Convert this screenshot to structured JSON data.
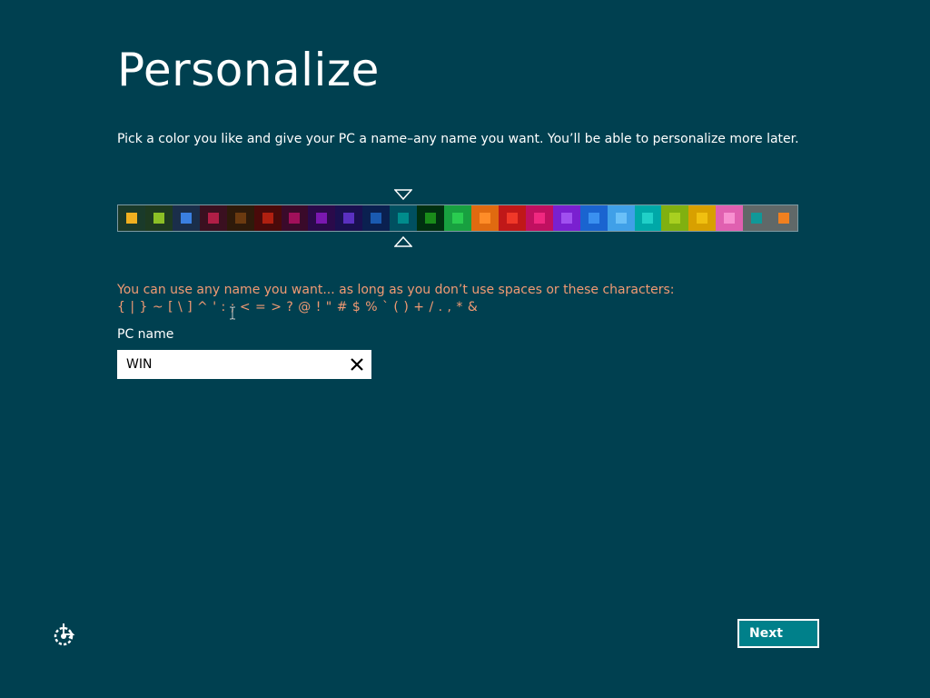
{
  "page": {
    "title": "Personalize",
    "subtitle": "Pick a color you like and give your PC a name–any name you want. You’ll be able to personalize more later.",
    "background_color": "#004050"
  },
  "color_picker": {
    "selected_index": 10,
    "swatches": [
      {
        "bg": "#1a3a2a",
        "fg": "#f0b020"
      },
      {
        "bg": "#1e3a20",
        "fg": "#8cbf26"
      },
      {
        "bg": "#1a2e4a",
        "fg": "#3a7fe0"
      },
      {
        "bg": "#3a1020",
        "fg": "#b01e46"
      },
      {
        "bg": "#2e1a0a",
        "fg": "#6b3a10"
      },
      {
        "bg": "#4a0a0a",
        "fg": "#b02010"
      },
      {
        "bg": "#3a0a2a",
        "fg": "#a0105a"
      },
      {
        "bg": "#2a0a4a",
        "fg": "#7a18b0"
      },
      {
        "bg": "#1a1050",
        "fg": "#5a30c0"
      },
      {
        "bg": "#0a2050",
        "fg": "#1a5ab0"
      },
      {
        "bg": "#005060",
        "fg": "#008c8c"
      },
      {
        "bg": "#003010",
        "fg": "#1a8c1a"
      },
      {
        "bg": "#18a040",
        "fg": "#2acc50"
      },
      {
        "bg": "#e06a10",
        "fg": "#ff8c28"
      },
      {
        "bg": "#c01818",
        "fg": "#f03828"
      },
      {
        "bg": "#c01060",
        "fg": "#f02880"
      },
      {
        "bg": "#7a20d0",
        "fg": "#a050f0"
      },
      {
        "bg": "#1a64d0",
        "fg": "#3a90f0"
      },
      {
        "bg": "#40a0e8",
        "fg": "#6ac0f8"
      },
      {
        "bg": "#00a8a8",
        "fg": "#20d0c8"
      },
      {
        "bg": "#80b010",
        "fg": "#a8d020"
      },
      {
        "bg": "#d8a000",
        "fg": "#f0c010"
      },
      {
        "bg": "#e060b0",
        "fg": "#f890d0"
      },
      {
        "bg": "#606868",
        "fg": "#109898"
      },
      {
        "bg": "#606868",
        "fg": "#f08020"
      }
    ]
  },
  "naming_rules": {
    "message": "You can use any name you want... as long as you don’t use spaces or these characters:",
    "characters": "{ | } ~ [ \\ ] ^ ' : ; < = > ? @ ! \" # $ % ` ( ) + / . , * &",
    "color": "#f19a73"
  },
  "pc_name": {
    "label": "PC name",
    "value": "WIN",
    "clear_icon": "close-icon"
  },
  "footer": {
    "next_label": "Next",
    "accessibility_icon": "ease-of-access-icon"
  }
}
